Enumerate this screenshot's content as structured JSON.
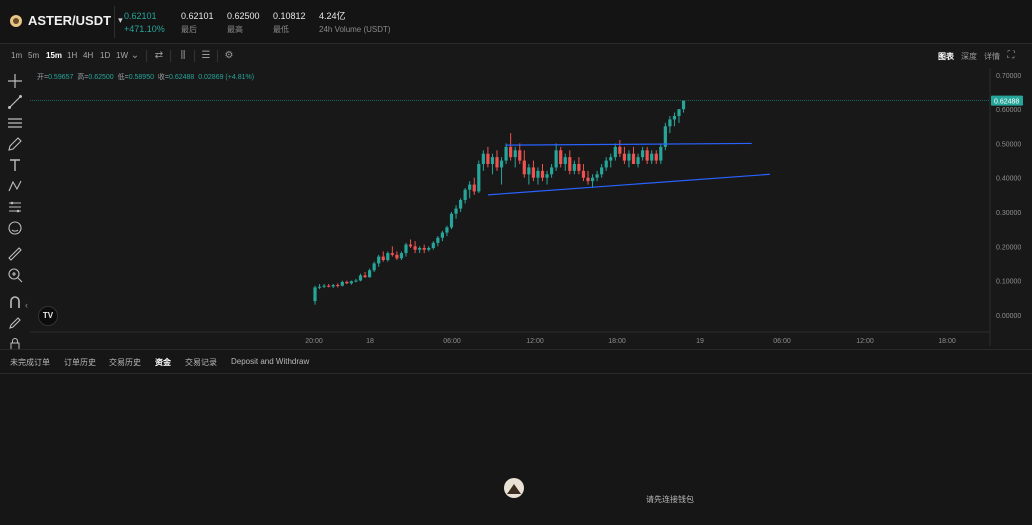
{
  "header": {
    "pair": "ASTER/USDT",
    "price": "0.62101",
    "change_pct": "+471.10%",
    "stats": [
      {
        "value": "0.62101",
        "label": "最后"
      },
      {
        "value": "0.62500",
        "label": "最高"
      },
      {
        "value": "0.10812",
        "label": "最低"
      },
      {
        "value": "4.24亿",
        "label": "24h Volume (USDT)"
      }
    ]
  },
  "toolbar": {
    "timeframes": [
      "1m",
      "5m",
      "15m",
      "1H",
      "4H",
      "1D",
      "1W"
    ],
    "active_timeframe": "15m",
    "view_tabs": [
      "图表",
      "深度",
      "详情"
    ],
    "active_view": "图表"
  },
  "ohlc": {
    "open_label": "开=",
    "open": "0.59657",
    "high_label": "高=",
    "high": "0.62500",
    "low_label": "低=",
    "low": "0.58950",
    "close_label": "收=",
    "close": "0.62488",
    "change": "0.02869 (+4.81%)"
  },
  "colors": {
    "up": "#26a69a",
    "down": "#ef5350",
    "trendline": "#2962ff",
    "price_tag": "#26a69a"
  },
  "chart_data": {
    "type": "candlestick",
    "y_range": [
      -0.05,
      0.72
    ],
    "y_ticks": [
      "0.70000",
      "0.60000",
      "0.50000",
      "0.40000",
      "0.30000",
      "0.20000",
      "0.10000",
      "0.00000"
    ],
    "y_tick_values": [
      0.7,
      0.6,
      0.5,
      0.4,
      0.3,
      0.2,
      0.1,
      0.0
    ],
    "x_ticks": [
      "20:00",
      "18",
      "06:00",
      "12:00",
      "18:00",
      "19",
      "06:00",
      "12:00",
      "18:00"
    ],
    "current_price": "0.62488",
    "ohlc": [
      [
        0.04,
        0.085,
        0.03,
        0.08
      ],
      [
        0.08,
        0.09,
        0.075,
        0.082
      ],
      [
        0.082,
        0.09,
        0.078,
        0.085
      ],
      [
        0.085,
        0.09,
        0.08,
        0.083
      ],
      [
        0.083,
        0.09,
        0.078,
        0.087
      ],
      [
        0.087,
        0.092,
        0.08,
        0.085
      ],
      [
        0.085,
        0.1,
        0.083,
        0.096
      ],
      [
        0.096,
        0.1,
        0.09,
        0.092
      ],
      [
        0.092,
        0.1,
        0.088,
        0.098
      ],
      [
        0.098,
        0.105,
        0.095,
        0.1
      ],
      [
        0.1,
        0.12,
        0.098,
        0.115
      ],
      [
        0.115,
        0.125,
        0.108,
        0.11
      ],
      [
        0.11,
        0.135,
        0.108,
        0.13
      ],
      [
        0.13,
        0.155,
        0.125,
        0.15
      ],
      [
        0.15,
        0.175,
        0.14,
        0.17
      ],
      [
        0.17,
        0.185,
        0.155,
        0.16
      ],
      [
        0.16,
        0.185,
        0.155,
        0.18
      ],
      [
        0.18,
        0.2,
        0.17,
        0.175
      ],
      [
        0.175,
        0.185,
        0.16,
        0.165
      ],
      [
        0.165,
        0.185,
        0.16,
        0.18
      ],
      [
        0.18,
        0.21,
        0.17,
        0.205
      ],
      [
        0.205,
        0.22,
        0.195,
        0.2
      ],
      [
        0.2,
        0.215,
        0.18,
        0.19
      ],
      [
        0.19,
        0.2,
        0.18,
        0.195
      ],
      [
        0.195,
        0.205,
        0.18,
        0.19
      ],
      [
        0.19,
        0.2,
        0.185,
        0.195
      ],
      [
        0.195,
        0.215,
        0.19,
        0.21
      ],
      [
        0.21,
        0.23,
        0.2,
        0.225
      ],
      [
        0.225,
        0.245,
        0.215,
        0.24
      ],
      [
        0.24,
        0.26,
        0.23,
        0.255
      ],
      [
        0.255,
        0.3,
        0.25,
        0.295
      ],
      [
        0.295,
        0.32,
        0.28,
        0.31
      ],
      [
        0.31,
        0.34,
        0.3,
        0.335
      ],
      [
        0.335,
        0.37,
        0.325,
        0.365
      ],
      [
        0.365,
        0.39,
        0.34,
        0.38
      ],
      [
        0.38,
        0.4,
        0.35,
        0.36
      ],
      [
        0.36,
        0.45,
        0.355,
        0.44
      ],
      [
        0.44,
        0.48,
        0.42,
        0.47
      ],
      [
        0.47,
        0.49,
        0.43,
        0.44
      ],
      [
        0.44,
        0.47,
        0.41,
        0.46
      ],
      [
        0.46,
        0.48,
        0.42,
        0.43
      ],
      [
        0.43,
        0.46,
        0.38,
        0.45
      ],
      [
        0.45,
        0.5,
        0.44,
        0.49
      ],
      [
        0.49,
        0.53,
        0.45,
        0.46
      ],
      [
        0.46,
        0.49,
        0.43,
        0.48
      ],
      [
        0.48,
        0.5,
        0.44,
        0.45
      ],
      [
        0.45,
        0.48,
        0.4,
        0.41
      ],
      [
        0.41,
        0.44,
        0.38,
        0.43
      ],
      [
        0.43,
        0.45,
        0.39,
        0.4
      ],
      [
        0.4,
        0.43,
        0.38,
        0.42
      ],
      [
        0.42,
        0.44,
        0.39,
        0.4
      ],
      [
        0.4,
        0.42,
        0.38,
        0.41
      ],
      [
        0.41,
        0.44,
        0.4,
        0.43
      ],
      [
        0.43,
        0.5,
        0.42,
        0.48
      ],
      [
        0.48,
        0.49,
        0.43,
        0.44
      ],
      [
        0.44,
        0.47,
        0.42,
        0.46
      ],
      [
        0.46,
        0.48,
        0.41,
        0.42
      ],
      [
        0.42,
        0.45,
        0.41,
        0.44
      ],
      [
        0.44,
        0.46,
        0.41,
        0.42
      ],
      [
        0.42,
        0.44,
        0.39,
        0.4
      ],
      [
        0.4,
        0.42,
        0.38,
        0.39
      ],
      [
        0.39,
        0.41,
        0.37,
        0.4
      ],
      [
        0.4,
        0.42,
        0.39,
        0.41
      ],
      [
        0.41,
        0.44,
        0.4,
        0.43
      ],
      [
        0.43,
        0.46,
        0.42,
        0.45
      ],
      [
        0.45,
        0.47,
        0.43,
        0.46
      ],
      [
        0.46,
        0.5,
        0.45,
        0.49
      ],
      [
        0.49,
        0.51,
        0.46,
        0.47
      ],
      [
        0.47,
        0.49,
        0.44,
        0.45
      ],
      [
        0.45,
        0.48,
        0.43,
        0.47
      ],
      [
        0.47,
        0.49,
        0.44,
        0.44
      ],
      [
        0.44,
        0.47,
        0.43,
        0.46
      ],
      [
        0.46,
        0.49,
        0.45,
        0.48
      ],
      [
        0.48,
        0.49,
        0.44,
        0.45
      ],
      [
        0.45,
        0.48,
        0.44,
        0.47
      ],
      [
        0.47,
        0.48,
        0.44,
        0.45
      ],
      [
        0.45,
        0.5,
        0.44,
        0.49
      ],
      [
        0.49,
        0.56,
        0.48,
        0.55
      ],
      [
        0.55,
        0.58,
        0.53,
        0.57
      ],
      [
        0.57,
        0.59,
        0.55,
        0.58
      ],
      [
        0.58,
        0.6,
        0.56,
        0.6
      ],
      [
        0.6,
        0.625,
        0.59,
        0.62488
      ]
    ],
    "trendlines": [
      {
        "from": [
          42,
          0.495
        ],
        "to": [
          96,
          0.5
        ]
      },
      {
        "from": [
          38,
          0.35
        ],
        "to": [
          100,
          0.41
        ]
      }
    ]
  },
  "bottom": {
    "tabs": [
      "未完成订单",
      "订单历史",
      "交易历史",
      "资金",
      "交易记录",
      "Deposit and Withdraw"
    ],
    "active_tab": "资金",
    "empty_text": "请先连接钱包"
  },
  "tv_logo": "TV"
}
